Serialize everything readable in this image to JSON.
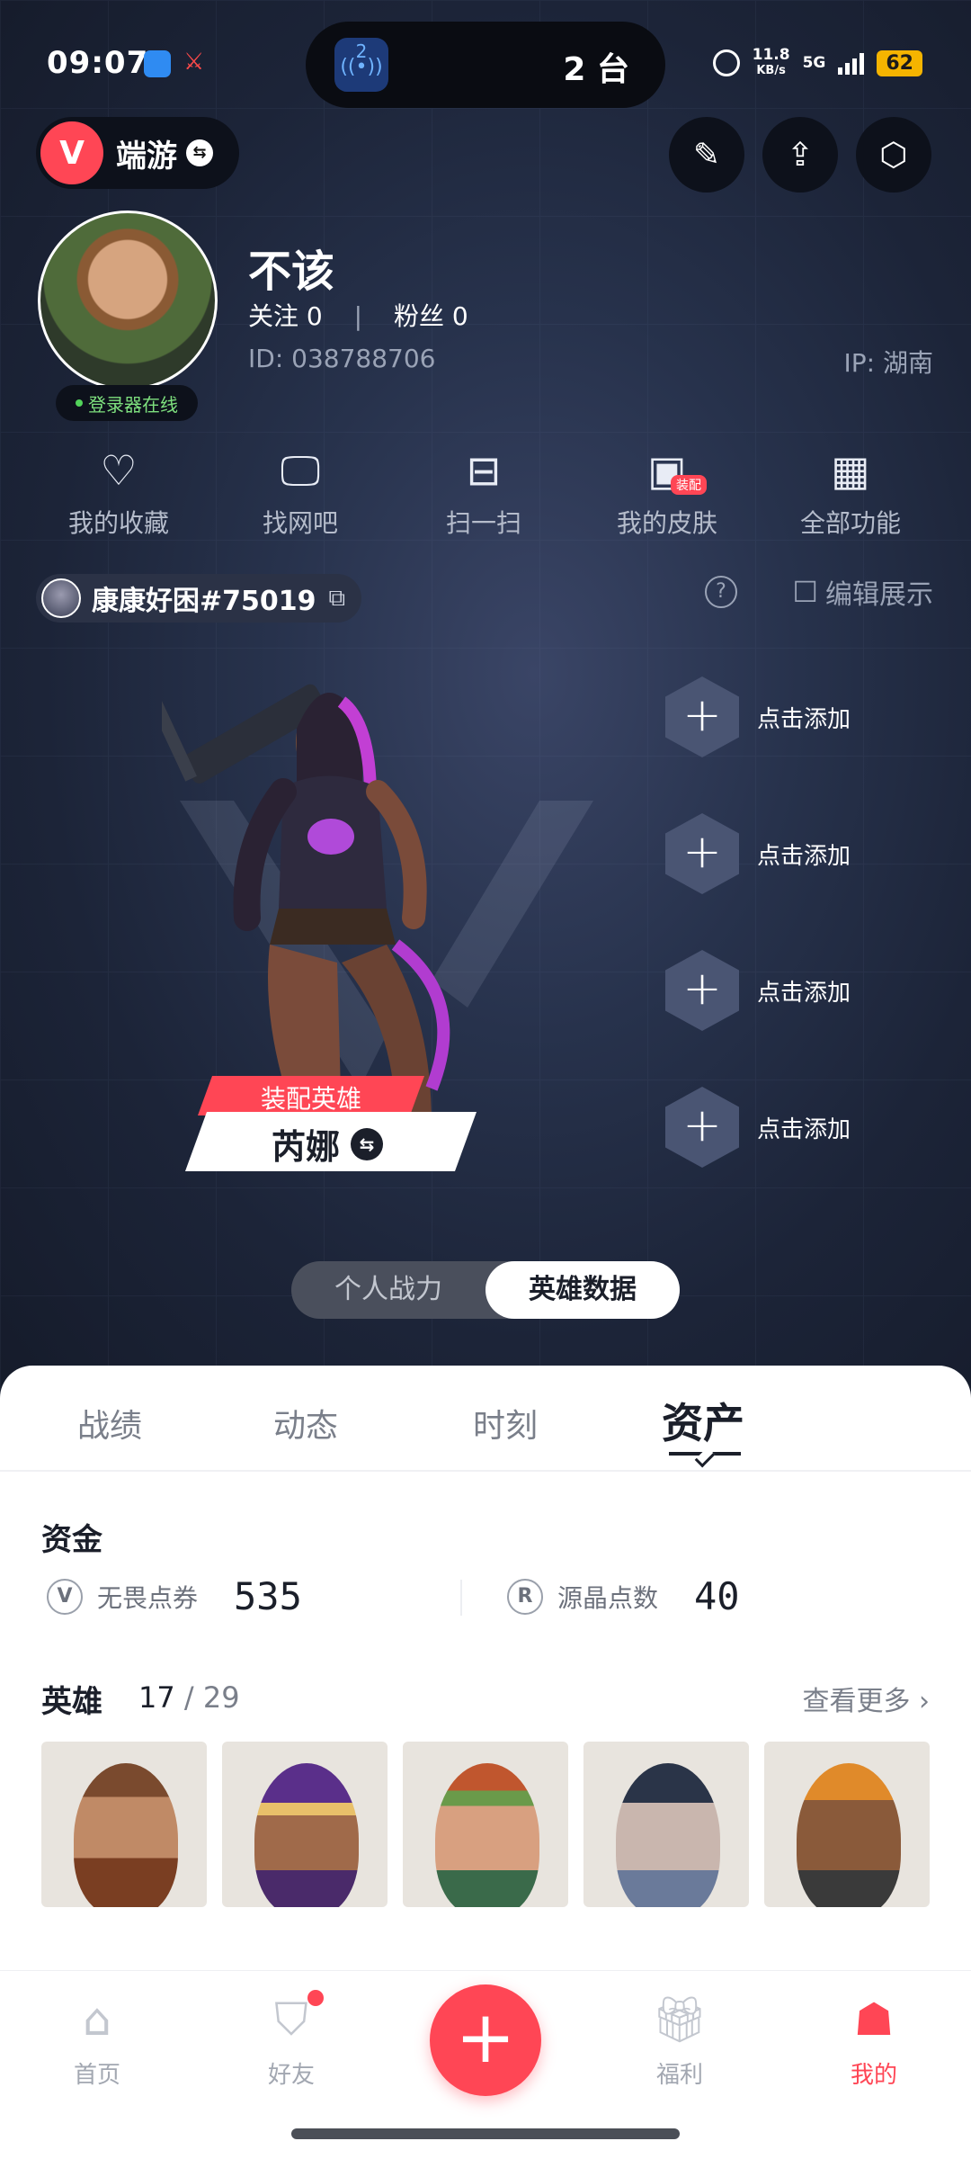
{
  "status_bar": {
    "time": "09:07",
    "island_badge": "2",
    "island_text": "2 台",
    "net_speed_value": "11.8",
    "net_speed_unit": "KB/s",
    "network": "5G",
    "battery": "62"
  },
  "header": {
    "game_name": "端游"
  },
  "profile": {
    "username": "不该",
    "follow_text": "关注 0",
    "fans_text": "粉丝 0",
    "separator": "|",
    "uid": "ID: 038788706",
    "ip": "IP: 湖南",
    "online_status": "登录器在线"
  },
  "quick_actions": [
    {
      "label": "我的收藏",
      "icon": "heart-icon"
    },
    {
      "label": "找网吧",
      "icon": "monitor-icon"
    },
    {
      "label": "扫一扫",
      "icon": "scan-icon"
    },
    {
      "label": "我的皮肤",
      "icon": "skin-icon",
      "tag": "装配"
    },
    {
      "label": "全部功能",
      "icon": "grid-icon"
    }
  ],
  "riot": {
    "name": "康康好困#75019",
    "edit_label": "编辑展示"
  },
  "showcase": {
    "add_label": "点击添加",
    "equip_tag": "装配英雄",
    "agent_name": "芮娜"
  },
  "segment": {
    "items": [
      "个人战力",
      "英雄数据"
    ],
    "active_index": 1
  },
  "tabs": {
    "items": [
      "战绩",
      "动态",
      "时刻",
      "资产"
    ],
    "active_index": 3
  },
  "funds": {
    "title": "资金",
    "items": [
      {
        "label": "无畏点券",
        "value": "535"
      },
      {
        "label": "源晶点数",
        "value": "40"
      }
    ]
  },
  "heroes": {
    "title": "英雄",
    "owned": "17",
    "total": "/ 29",
    "see_more": "查看更多 ›"
  },
  "bottom_nav": {
    "items": [
      "首页",
      "好友",
      "福利",
      "我的"
    ],
    "active_index": 3
  },
  "colors": {
    "accent": "#ff4655",
    "dark_bg": "#1c2438"
  }
}
